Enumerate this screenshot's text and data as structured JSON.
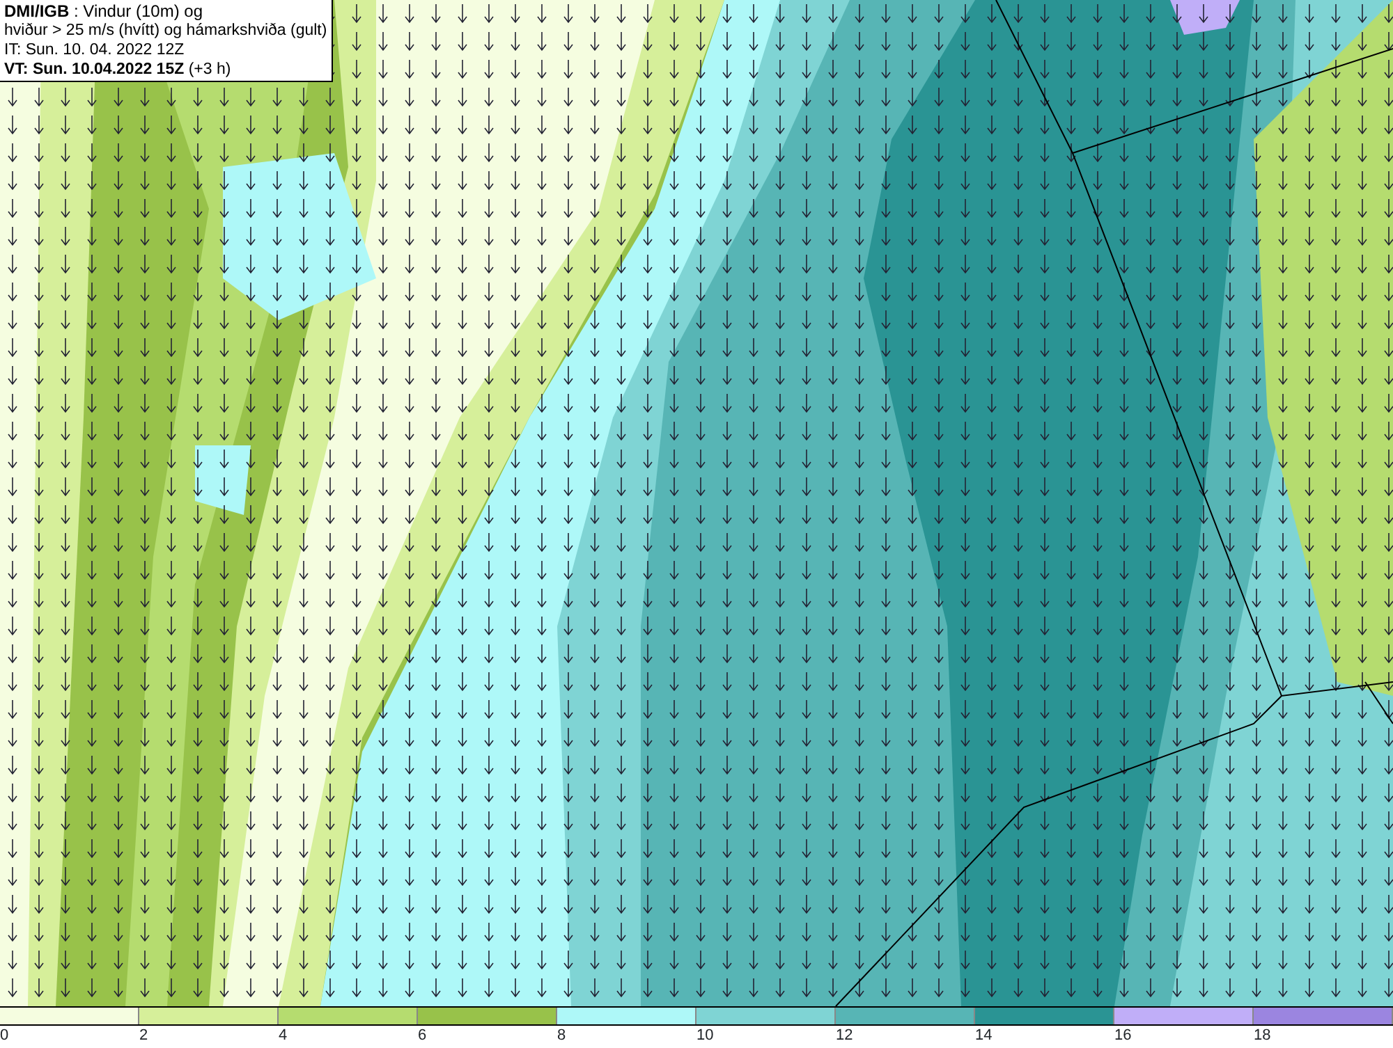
{
  "header": {
    "lines": [
      "**DMI/IGB** : Vindur (10m) og",
      "hviður > 25 m/s (hvítt) og hámarkshviða (gult)",
      "IT: Sun. 10. 04. 2022 12Z",
      "**VT: Sun. 10.04.2022 15Z** (+3 h)"
    ]
  },
  "legend": {
    "bins": [
      {
        "color": "#f5fde0"
      },
      {
        "color": "#d6ef9a"
      },
      {
        "color": "#b5dc6f"
      },
      {
        "color": "#98c24a"
      },
      {
        "color": "#aef8f8"
      },
      {
        "color": "#7fd4d4"
      },
      {
        "color": "#57b5b5"
      },
      {
        "color": "#2a9494"
      },
      {
        "color": "#c0aef8"
      },
      {
        "color": "#9b85e0"
      }
    ],
    "ticks": [
      "0",
      "2",
      "4",
      "6",
      "8",
      "10",
      "12",
      "14",
      "16",
      "18"
    ]
  }
}
